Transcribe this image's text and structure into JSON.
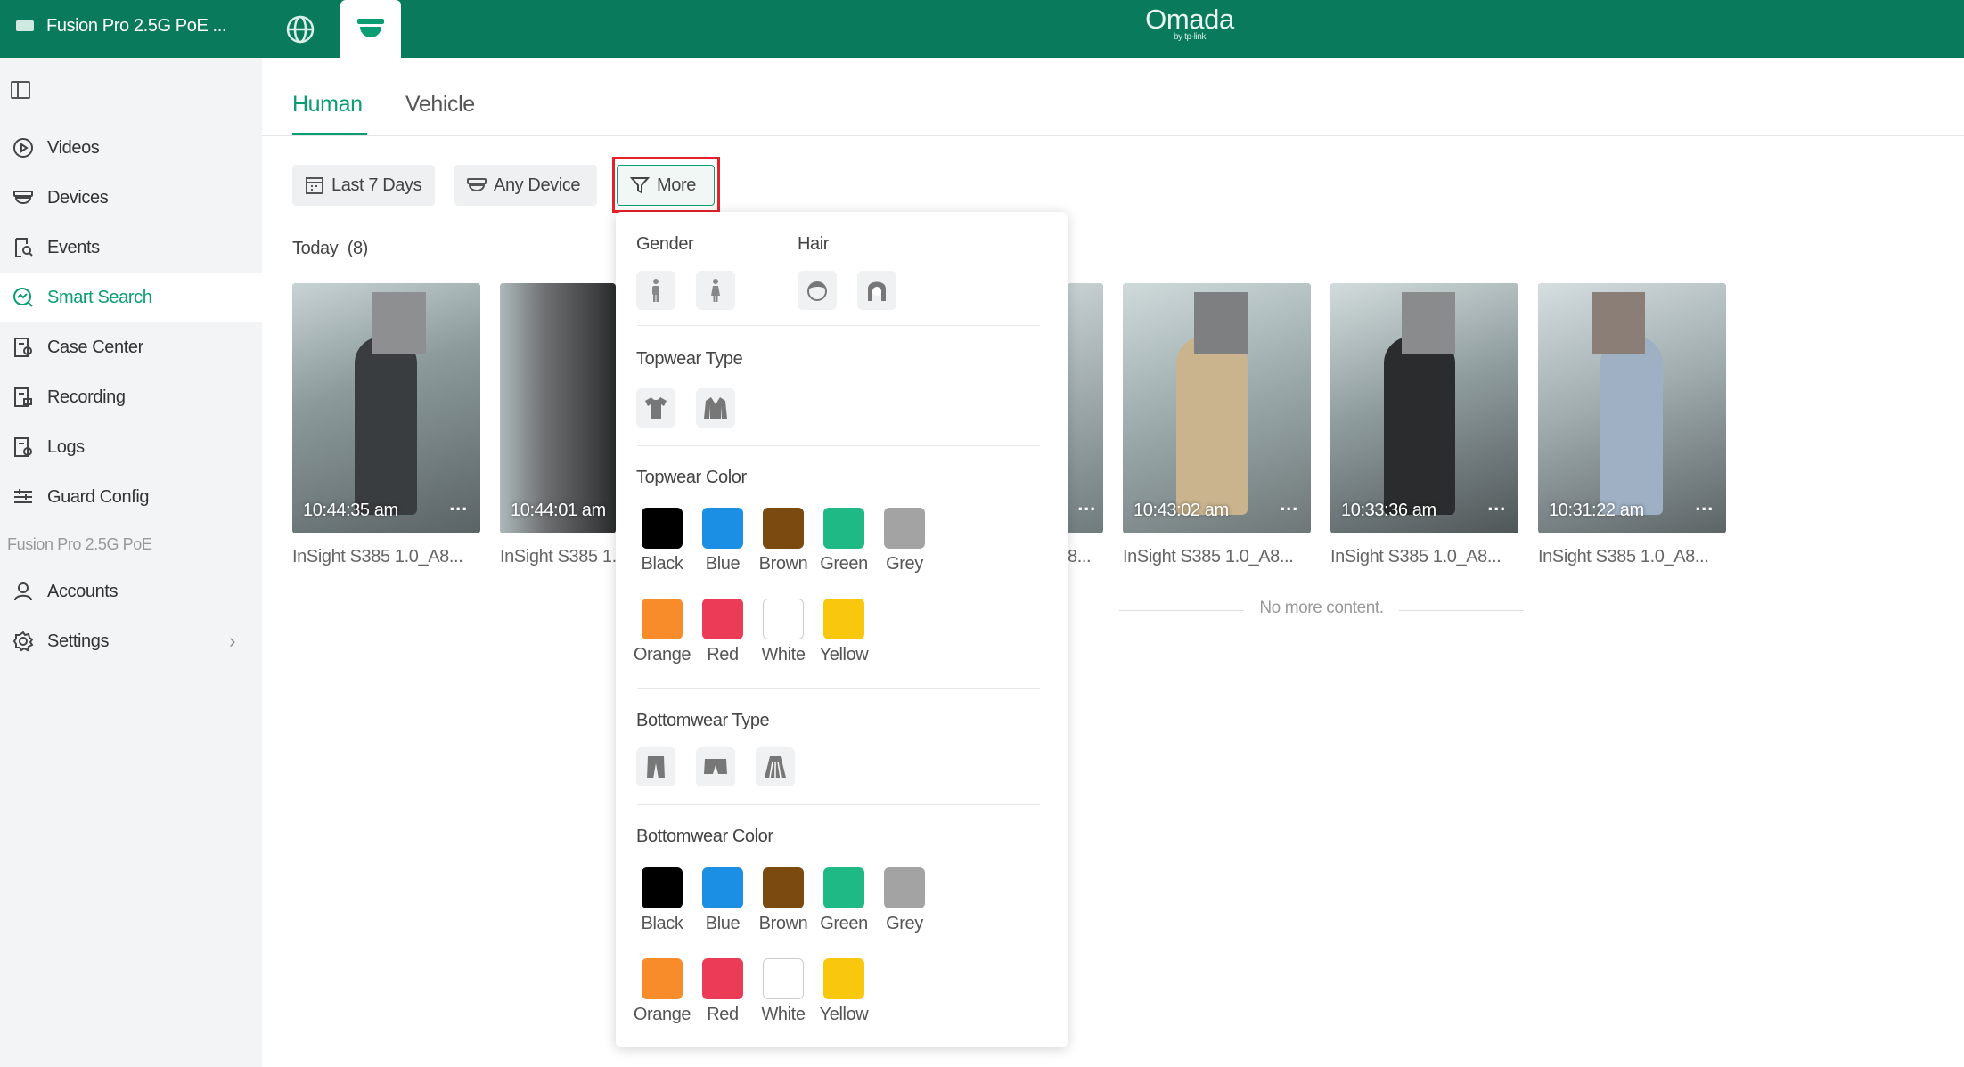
{
  "topbar": {
    "device_name": "Fusion Pro 2.5G PoE ...",
    "logo": "Omada",
    "logo_sub": "by tp-link"
  },
  "sidebar": {
    "items": [
      {
        "label": "Videos",
        "icon": "play-circle-icon"
      },
      {
        "label": "Devices",
        "icon": "camera-dome-icon"
      },
      {
        "label": "Events",
        "icon": "event-search-icon"
      },
      {
        "label": "Smart Search",
        "icon": "smart-search-icon",
        "active": true
      },
      {
        "label": "Case Center",
        "icon": "case-icon"
      },
      {
        "label": "Recording",
        "icon": "recording-icon"
      },
      {
        "label": "Logs",
        "icon": "logs-icon"
      },
      {
        "label": "Guard Config",
        "icon": "sliders-icon"
      }
    ],
    "section_label": "Fusion Pro 2.5G PoE",
    "bottom_items": [
      {
        "label": "Accounts",
        "icon": "user-icon"
      },
      {
        "label": "Settings",
        "icon": "gear-icon"
      }
    ]
  },
  "tabs": [
    {
      "label": "Human",
      "active": true
    },
    {
      "label": "Vehicle"
    }
  ],
  "filters": {
    "date": "Last 7 Days",
    "device": "Any Device",
    "more": "More"
  },
  "results": {
    "heading": "Today",
    "count": "(8)",
    "items": [
      {
        "time": "10:44:35 am",
        "camera": "InSight S385 1.0_A8..."
      },
      {
        "time": "10:44:01 am",
        "camera": "InSight S385 1."
      },
      {
        "time": "",
        "camera": "8..."
      },
      {
        "time": "10:43:02 am",
        "camera": "InSight S385 1.0_A8..."
      },
      {
        "time": "10:33:36 am",
        "camera": "InSight S385 1.0_A8..."
      },
      {
        "time": "10:31:22 am",
        "camera": "InSight S385 1.0_A8..."
      }
    ],
    "no_more": "No more content."
  },
  "panel": {
    "gender_label": "Gender",
    "hair_label": "Hair",
    "topwear_type_label": "Topwear Type",
    "topwear_color_label": "Topwear Color",
    "bottomwear_type_label": "Bottomwear Type",
    "bottomwear_color_label": "Bottomwear Color",
    "colors": [
      {
        "name": "Black",
        "hex": "#000000"
      },
      {
        "name": "Blue",
        "hex": "#1a8fe3"
      },
      {
        "name": "Brown",
        "hex": "#7a4a10"
      },
      {
        "name": "Green",
        "hex": "#1fb985"
      },
      {
        "name": "Grey",
        "hex": "#a3a3a3"
      },
      {
        "name": "Orange",
        "hex": "#f98c2a"
      },
      {
        "name": "Red",
        "hex": "#ec3b56"
      },
      {
        "name": "White",
        "hex": "#ffffff"
      },
      {
        "name": "Yellow",
        "hex": "#f9c80e"
      }
    ]
  }
}
